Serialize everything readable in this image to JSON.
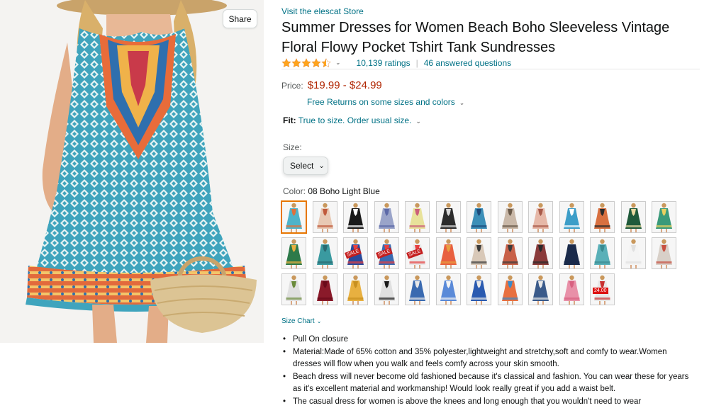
{
  "share_label": "Share",
  "store_link": "Visit the elescat Store",
  "title": "Summer Dresses for Women Beach Boho Sleeveless Vintage Floral Flowy Pocket Tshirt Tank Sundresses",
  "rating": {
    "stars": 4.5,
    "ratings_count": "10,139 ratings",
    "answered": "46 answered questions"
  },
  "price": {
    "label": "Price:",
    "value": "$19.99 - $24.99"
  },
  "returns": "Free Returns on some sizes and colors",
  "fit": {
    "label": "Fit:",
    "text": "True to size. Order usual size."
  },
  "size": {
    "label": "Size:",
    "select_value": "Select"
  },
  "color": {
    "label": "Color:",
    "value": "08 Boho Light Blue"
  },
  "swatches": [
    {
      "color": "#4fb3c9",
      "accent": "#e1703b",
      "selected": true
    },
    {
      "color": "#e8c9b4",
      "accent": "#c05a3c"
    },
    {
      "color": "#1a1a1a",
      "accent": "#ffffff"
    },
    {
      "color": "#9aa4c9",
      "accent": "#5d6aa8"
    },
    {
      "color": "#e8e29a",
      "accent": "#cc5f7a"
    },
    {
      "color": "#2c2c2c",
      "accent": "#d8d8d8"
    },
    {
      "color": "#3c8fb8",
      "accent": "#1c4a7a"
    },
    {
      "color": "#c9b8a8",
      "accent": "#6a5a4a"
    },
    {
      "color": "#e6b8a8",
      "accent": "#a85a4a"
    },
    {
      "color": "#3d9ec8",
      "accent": "#ffffff"
    },
    {
      "color": "#d87040",
      "accent": "#2a2a2a"
    },
    {
      "color": "#1f5a3a",
      "accent": "#e8d8a0"
    },
    {
      "color": "#3a9a7a",
      "accent": "#e8d060"
    },
    {
      "color": "#2d7a4a",
      "accent": "#e8b040"
    },
    {
      "color": "#3a9aa0",
      "accent": "#2a6a70"
    },
    {
      "color": "#2a4a9a",
      "accent": "#e84040",
      "tag": "SALE"
    },
    {
      "color": "#3a6ab0",
      "accent": "#e84040",
      "tag": "SALE"
    },
    {
      "color": "#e8e8e8",
      "accent": "#e84040",
      "tag": "SALE"
    },
    {
      "color": "#e86040",
      "accent": "#e8a040"
    },
    {
      "color": "#d8c8b8",
      "accent": "#3a3a3a"
    },
    {
      "color": "#c86048",
      "accent": "#3a3a3a"
    },
    {
      "color": "#8a3a3a",
      "accent": "#2a2a2a"
    },
    {
      "color": "#1a2a4a",
      "accent": "#1a2a4a"
    },
    {
      "color": "#5ab0b8",
      "accent": "#3a8a90"
    },
    {
      "color": "#f4f4f4",
      "accent": "#e0e0e0"
    },
    {
      "color": "#d8d0c8",
      "accent": "#c85040"
    },
    {
      "color": "#e0e0e0",
      "accent": "#6a8a3a"
    },
    {
      "color": "#8a1a2a",
      "accent": "#6a0a1a"
    },
    {
      "color": "#e8b040",
      "accent": "#c89020"
    },
    {
      "color": "#e0e0e0",
      "accent": "#1a1a1a"
    },
    {
      "color": "#3a6ab0",
      "accent": "#e8e8e8"
    },
    {
      "color": "#5a8ad8",
      "accent": "#f4f4f4"
    },
    {
      "color": "#2a5ab0",
      "accent": "#e8e8e8"
    },
    {
      "color": "#e87040",
      "accent": "#3a8ac8"
    },
    {
      "color": "#3a5a8a",
      "accent": "#e8e8e8"
    },
    {
      "color": "#e890a8",
      "accent": "#d86080"
    },
    {
      "color": "#e8e8e8",
      "accent": "#c83030",
      "tag": "24.00"
    }
  ],
  "size_chart": "Size Chart",
  "bullets": [
    "Pull On closure",
    "Material:Made of 65% cotton and 35% polyester,lightweight and stretchy,soft and comfy to wear.Women dresses will flow when you walk and feels comfy across your skin smooth.",
    "Beach dress will never become old fashioned because it's classical and fashion. You can wear these for years as it's excellent material and workmanship! Would look really great if you add a waist belt.",
    "The casual dress for women is above the knees and long enough that you wouldn't need to wear"
  ],
  "colors": {
    "link": "#007185",
    "price": "#b12704",
    "star": "#ffa41c",
    "selected_border": "#e77600"
  }
}
